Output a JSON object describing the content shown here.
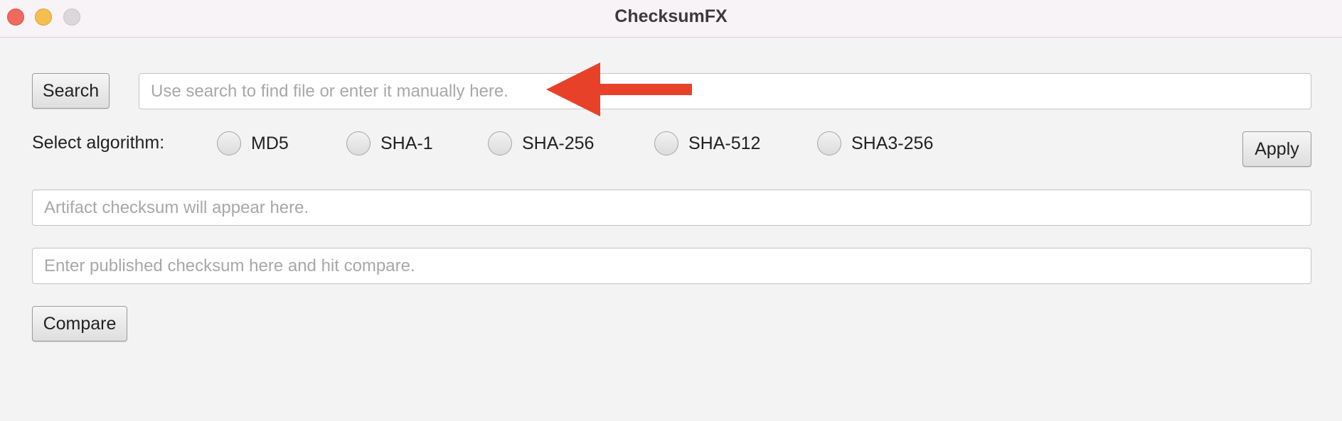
{
  "window": {
    "title": "ChecksumFX"
  },
  "search": {
    "button_label": "Search",
    "placeholder": "Use search to find file or enter it manually here.",
    "value": ""
  },
  "algorithm": {
    "label": "Select algorithm:",
    "options": [
      {
        "label": "MD5",
        "selected": false
      },
      {
        "label": "SHA-1",
        "selected": false
      },
      {
        "label": "SHA-256",
        "selected": false
      },
      {
        "label": "SHA-512",
        "selected": false
      },
      {
        "label": "SHA3-256",
        "selected": false
      }
    ],
    "apply_label": "Apply"
  },
  "artifact": {
    "placeholder": "Artifact checksum will appear here.",
    "value": ""
  },
  "published": {
    "placeholder": "Enter published checksum here and hit compare.",
    "value": ""
  },
  "compare": {
    "button_label": "Compare"
  },
  "colors": {
    "arrow": "#e8412a",
    "close": "#ee6a5f",
    "minimize": "#f5bf4f",
    "zoom": "#dcd7db"
  }
}
